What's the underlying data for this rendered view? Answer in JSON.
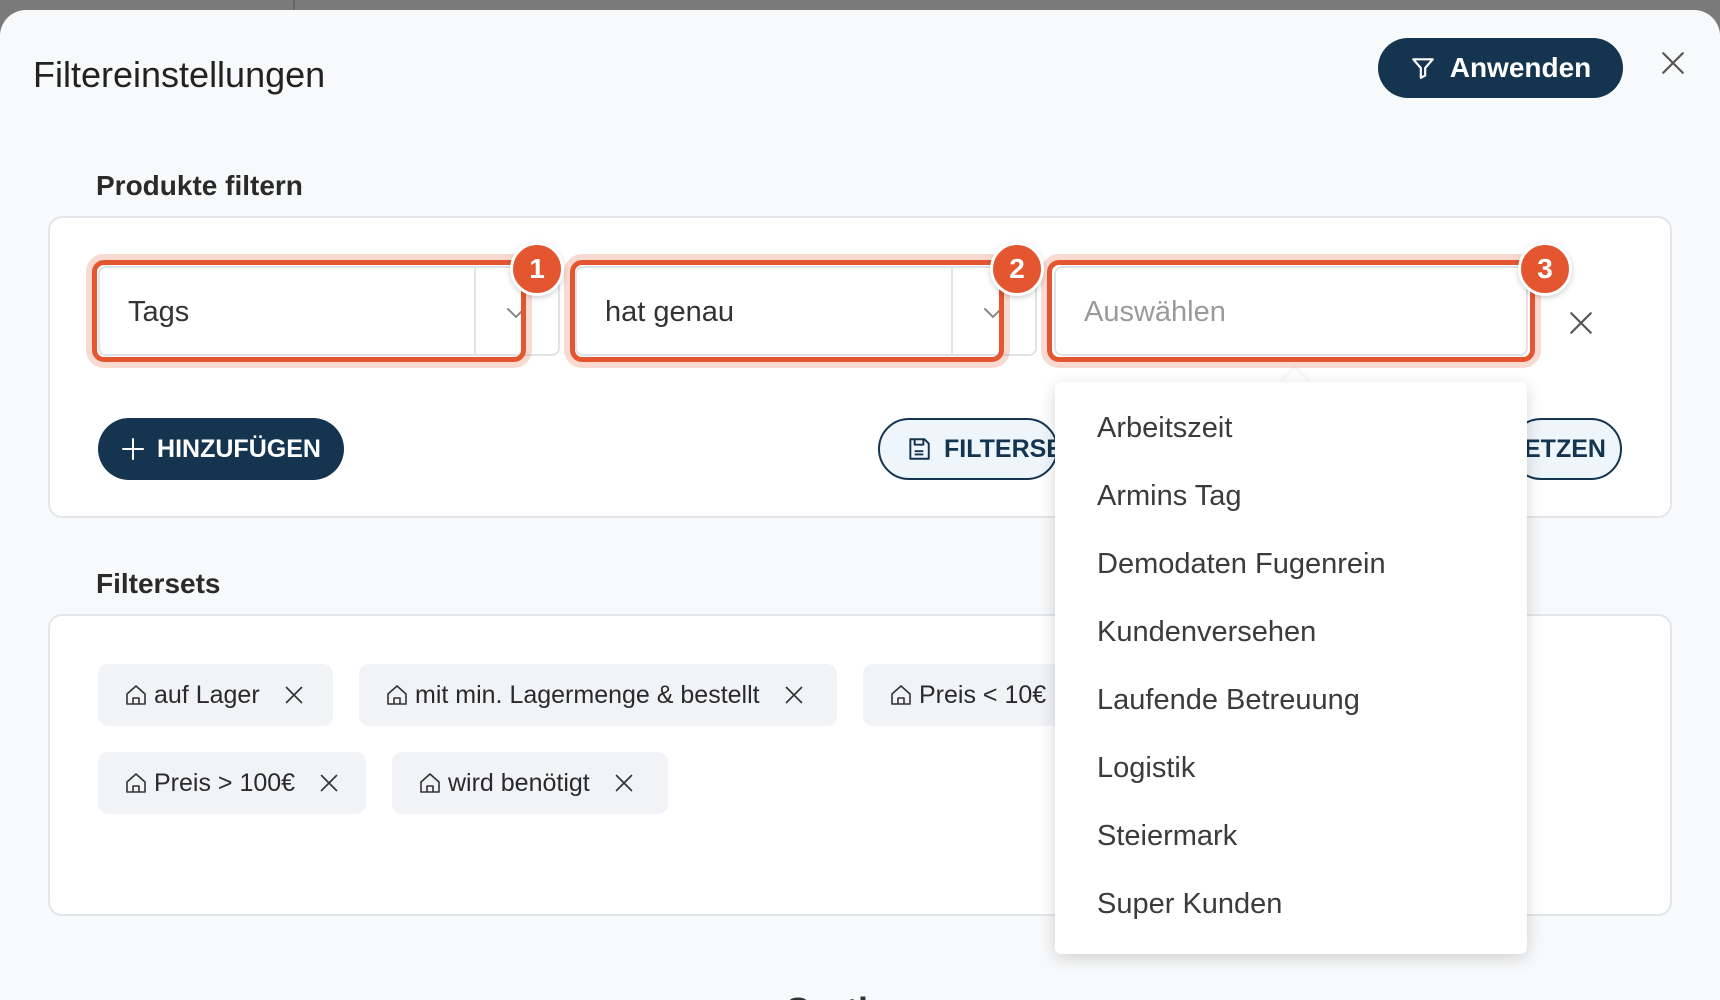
{
  "modal": {
    "title": "Filtereinstellungen",
    "apply_label": "Anwenden"
  },
  "products_filter": {
    "section_title": "Produkte filtern",
    "field_value": "Tags",
    "operator_value": "hat genau",
    "value_placeholder": "Auswählen",
    "add_label": "HINZUFÜGEN",
    "save_filterset_label": "FILTERSE",
    "reset_label": "ETZEN"
  },
  "badges": [
    "1",
    "2",
    "3"
  ],
  "filtersets": {
    "section_title": "Filtersets",
    "chips": [
      {
        "label": "auf Lager"
      },
      {
        "label": "mit min. Lagermenge & bestellt"
      },
      {
        "label": "Preis < 10€"
      },
      {
        "label": "Preis > 100€"
      },
      {
        "label": "wird benötigt"
      }
    ]
  },
  "dropdown": {
    "options": [
      "Arbeitszeit",
      "Armins Tag",
      "Demodaten Fugenrein",
      "Kundenversehen",
      "Laufende Betreuung",
      "Logistik",
      "Steiermark",
      "Super Kunden"
    ]
  },
  "next_section_peek": "Sorti",
  "colors": {
    "primary": "#14344f",
    "highlight": "#e4562f"
  }
}
